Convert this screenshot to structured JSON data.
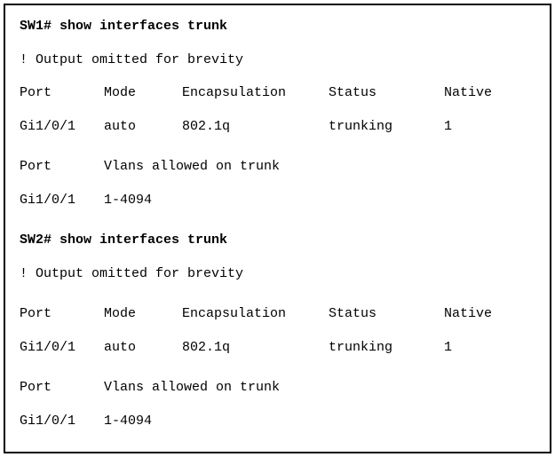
{
  "sw1": {
    "command": "SW1# show interfaces trunk",
    "omitted": "! Output omitted for brevity",
    "headers1": {
      "port": "Port",
      "mode": "Mode",
      "encap": "Encapsulation",
      "status": "Status",
      "native": "Native"
    },
    "row1": {
      "port": "Gi1/0/1",
      "mode": "auto",
      "encap": "802.1q",
      "status": "trunking",
      "native": "1"
    },
    "headers2": {
      "port": "Port",
      "vlans": "Vlans allowed on trunk"
    },
    "row2": {
      "port": "Gi1/0/1",
      "vlans": "1-4094"
    }
  },
  "sw2": {
    "command": "SW2# show interfaces trunk",
    "omitted": "! Output omitted for brevity",
    "headers1": {
      "port": "Port",
      "mode": "Mode",
      "encap": "Encapsulation",
      "status": "Status",
      "native": "Native"
    },
    "row1": {
      "port": "Gi1/0/1",
      "mode": "auto",
      "encap": "802.1q",
      "status": "trunking",
      "native": "1"
    },
    "headers2": {
      "port": "Port",
      "vlans": "Vlans allowed on trunk"
    },
    "row2": {
      "port": "Gi1/0/1",
      "vlans": "1-4094"
    }
  }
}
